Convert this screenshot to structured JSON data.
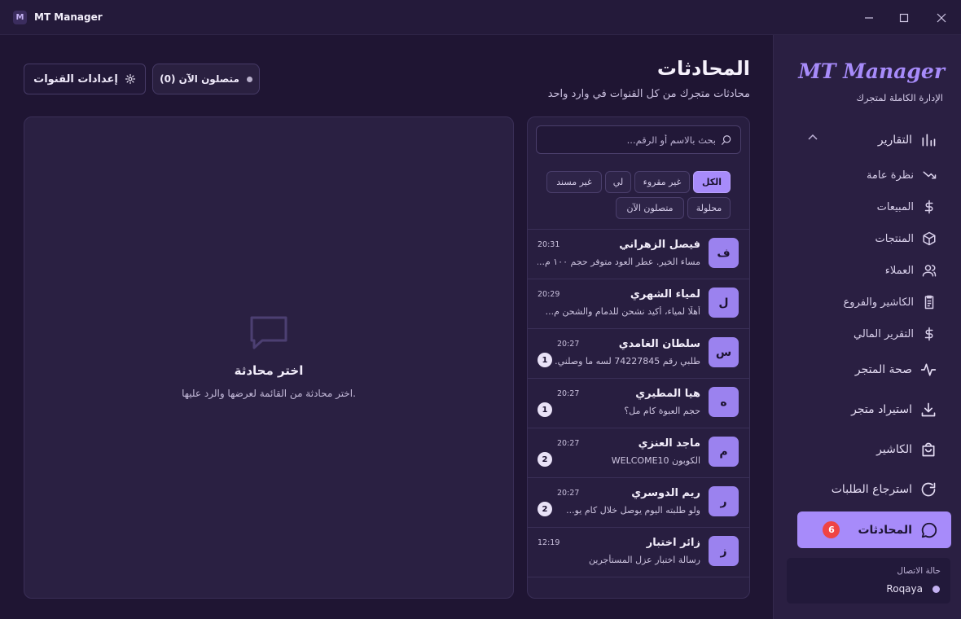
{
  "window": {
    "title": "MT Manager",
    "logo_letter": "M"
  },
  "sidebar": {
    "brand": "MT Manager",
    "brand_subtitle": "الإدارة الكاملة لمتجرك",
    "reports": {
      "label": "التقارير",
      "expanded": true
    },
    "report_items": [
      {
        "label": "نظرة عامة",
        "icon": "trend-icon"
      },
      {
        "label": "المبيعات",
        "icon": "dollar-icon"
      },
      {
        "label": "المنتجات",
        "icon": "box-icon"
      },
      {
        "label": "العملاء",
        "icon": "users-icon"
      },
      {
        "label": "الكاشير والفروع",
        "icon": "clipboard-icon"
      },
      {
        "label": "التقرير المالي",
        "icon": "dollar-icon"
      }
    ],
    "items": [
      {
        "label": "صحة المتجر",
        "icon": "pulse-icon"
      },
      {
        "label": "استيراد متجر",
        "icon": "download-icon"
      },
      {
        "label": "الكاشير",
        "icon": "bag-icon"
      },
      {
        "label": "استرجاع الطلبات",
        "icon": "refresh-icon"
      }
    ],
    "active_item": {
      "label": "المحادثات",
      "icon": "chat-icon",
      "badge": "6"
    },
    "connection": {
      "title": "حالة الاتصال",
      "user": "Roqaya",
      "status_color": "#c4b1f2"
    }
  },
  "header": {
    "title": "المحادثات",
    "subtitle": "محادثات متجرك من كل القنوات في وارد واحد",
    "settings_button": "إعدادات القنوات",
    "online_pill": "متصلون الآن (0)"
  },
  "search": {
    "placeholder": "بحث بالاسم أو الرقم..."
  },
  "filters": {
    "all": "الكل",
    "unread": "غير مقروء",
    "mine": "لي",
    "unassigned": "غير مسند",
    "resolved": "محلولة",
    "online": "متصلون الآن"
  },
  "conversations": [
    {
      "initial": "ف",
      "name": "فيصل الزهراني",
      "message": "مساء الخير. عطر العود متوفر حجم ١٠٠ م...",
      "time": "20:31",
      "unread": ""
    },
    {
      "initial": "ل",
      "name": "لمياء الشهري",
      "message": "أهلًا لمياء، أكيد نشحن للدمام والشحن م...",
      "time": "20:29",
      "unread": ""
    },
    {
      "initial": "س",
      "name": "سلطان الغامدي",
      "message": "طلبي رقم 74227845 لسه ما وصلني...",
      "time": "20:27",
      "unread": "1"
    },
    {
      "initial": "ه",
      "name": "هيا المطيري",
      "message": "حجم العبوة كام مل؟",
      "time": "20:27",
      "unread": "1"
    },
    {
      "initial": "م",
      "name": "ماجد العنزي",
      "message": "الكوبون WELCOME10",
      "time": "20:27",
      "unread": "2"
    },
    {
      "initial": "ر",
      "name": "ريم الدوسري",
      "message": "ولو طلبته اليوم يوصل خلال كام يو...",
      "time": "20:27",
      "unread": "2"
    },
    {
      "initial": "ز",
      "name": "زائر اختبار",
      "message": "رسالة اختبار عزل المستأجرين",
      "time": "12:19",
      "unread": ""
    }
  ],
  "empty_state": {
    "title": "اختر محادثة",
    "subtitle": "اختر محادثة من القائمة لعرضها والرد عليها."
  },
  "colors": {
    "accent": "#a78bfa",
    "badge": "#ef4444",
    "background": "#1f1533"
  }
}
